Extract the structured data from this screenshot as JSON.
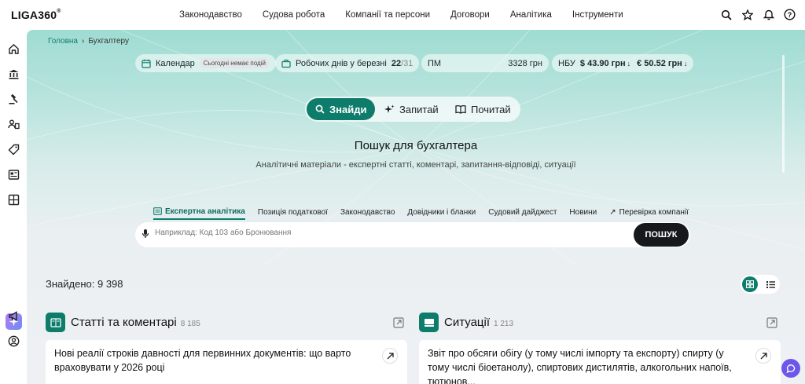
{
  "app": {
    "logo": "LIGA360",
    "logo_mark": "®"
  },
  "nav": [
    "Законодавство",
    "Судова робота",
    "Компанії та персони",
    "Договори",
    "Аналітика",
    "Інструменти"
  ],
  "top_icons": [
    "search-icon",
    "star-icon",
    "bell-icon",
    "help-icon"
  ],
  "breadcrumb": {
    "home": "Головна",
    "separator": "›",
    "current": "Бухгалтеру"
  },
  "info_bar": {
    "calendar": {
      "label": "Календар",
      "tag": "Сьогодні немає подій"
    },
    "workdays": {
      "label": "Робочих днів у березні",
      "value": "22",
      "total": "/31"
    },
    "pm": {
      "label": "ПМ",
      "value": "3328 грн"
    },
    "nbu": {
      "label": "НБУ",
      "usd": "$ 43.90 грн",
      "eur": "€ 50.52 грн"
    }
  },
  "modes": [
    {
      "label": "Знайди",
      "active": true
    },
    {
      "label": "Запитай",
      "active": false
    },
    {
      "label": "Почитай",
      "active": false
    }
  ],
  "hero": {
    "title": "Пошук для бухгалтера",
    "subtitle": "Аналітичні матеріали - експертні статті, коментарі, запитання-відповіді, ситуації"
  },
  "tabs": [
    {
      "label": "Експертна аналітика",
      "active": true
    },
    {
      "label": "Позиція податкової",
      "active": false
    },
    {
      "label": "Законодавство",
      "active": false
    },
    {
      "label": "Довідники і бланки",
      "active": false
    },
    {
      "label": "Судовий дайджест",
      "active": false
    },
    {
      "label": "Новини",
      "active": false
    },
    {
      "label": "Перевірка компанії",
      "active": false,
      "prefix": "↗"
    }
  ],
  "search": {
    "placeholder": "Наприклад: Код 103 або Бронювання",
    "value": "",
    "button": "ПОШУК"
  },
  "results": {
    "found_label": "Знайдено: 9 398"
  },
  "sections": [
    {
      "title": "Статті та коментарі",
      "count": "8 185",
      "first_item": "Нові реалії строків давності для первинних документів: що варто враховувати у 2026 році"
    },
    {
      "title": "Ситуації",
      "count": "1 213",
      "first_item": "Звіт про обсяги обігу (у тому числі імпорту та експорту) спирту (у тому числі біоетанолу), спиртових дистилятів, алкогольних напоїв, тютюнов..."
    }
  ],
  "colors": {
    "accent": "#0e7c6b",
    "dark_button": "#16191b",
    "chat": "#6b58e8"
  }
}
